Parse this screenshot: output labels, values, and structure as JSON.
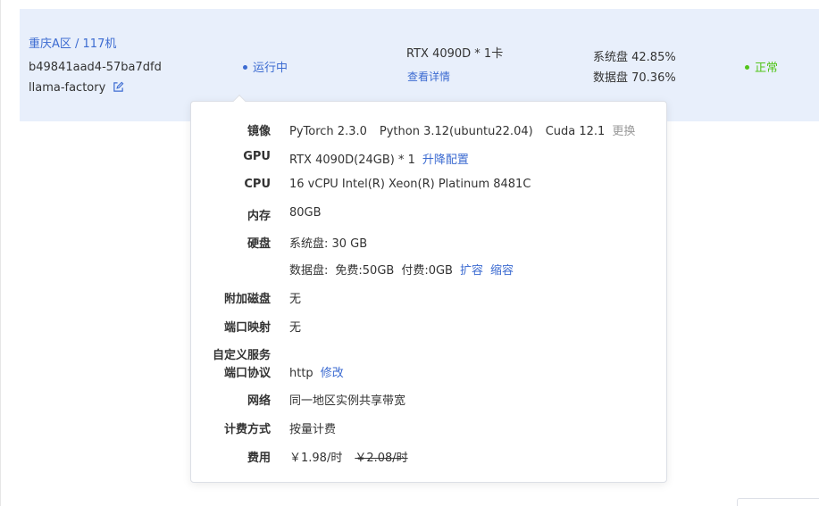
{
  "instance": {
    "region_link": "重庆A区 / 117机",
    "id": "b49841aad4-57ba7dfd",
    "name": "llama-factory",
    "status": "运行中",
    "gpu_summary": "RTX 4090D * 1卡",
    "details_link": "查看详情",
    "system_disk": "系统盘 42.85%",
    "data_disk": "数据盘 70.36%",
    "health": "正常",
    "status_color": "#3c6bd1",
    "health_color": "#52c41a"
  },
  "details": {
    "image": {
      "label": "镜像",
      "pytorch": "PyTorch  2.3.0",
      "python": "Python  3.12(ubuntu22.04)",
      "cuda": "Cuda  12.1",
      "change_link": "更换"
    },
    "gpu": {
      "label": "GPU",
      "value": "RTX 4090D(24GB) * 1",
      "upgrade_link": "升降配置"
    },
    "cpu": {
      "label": "CPU",
      "value": "16 vCPU Intel(R) Xeon(R) Platinum 8481C"
    },
    "memory": {
      "label": "内存",
      "value": "80GB"
    },
    "disk": {
      "label": "硬盘",
      "system": "系统盘:  30 GB",
      "data_prefix": "数据盘:",
      "data_free": "免费:50GB",
      "data_paid": "付费:0GB",
      "expand_link": "扩容",
      "shrink_link": "缩容"
    },
    "extra_disk": {
      "label": "附加磁盘",
      "value": "无"
    },
    "port_mapping": {
      "label": "端口映射",
      "value": "无"
    },
    "custom_service": {
      "label_line1": "自定义服务",
      "label_line2": "端口协议",
      "value": "http",
      "edit_link": "修改"
    },
    "network": {
      "label": "网络",
      "value": "同一地区实例共享带宽"
    },
    "billing": {
      "label": "计费方式",
      "value": "按量计费"
    },
    "fee": {
      "label": "费用",
      "current": "￥1.98/时",
      "original": "￥2.08/时"
    }
  }
}
